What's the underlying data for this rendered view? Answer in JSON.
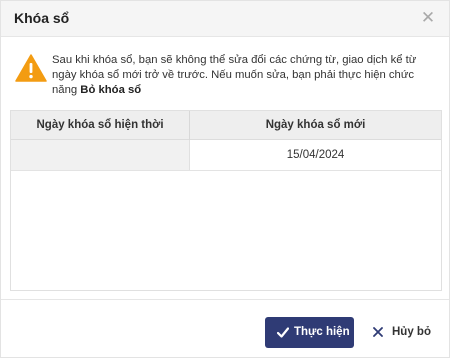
{
  "dialog": {
    "title": "Khóa sổ",
    "close_icon": "close-icon"
  },
  "warning": {
    "icon": "warning-icon",
    "text": "Sau khi khóa sổ, bạn sẽ không thể sửa đổi các chứng từ, giao dịch kể từ ngày khóa sổ mới trở về trước. Nếu muốn sửa, bạn phải thực hiện chức năng ",
    "emphasis": "Bỏ khóa sổ",
    "icon_color": "#f39c12"
  },
  "table": {
    "columns": [
      "Ngày khóa sổ hiện thời",
      "Ngày khóa sổ mới"
    ],
    "rows": [
      {
        "current": "",
        "new": "15/04/2024"
      }
    ]
  },
  "buttons": {
    "confirm_label": "Thực hiện",
    "cancel_label": "Hủy bỏ",
    "confirm_color": "#2f3b75"
  }
}
